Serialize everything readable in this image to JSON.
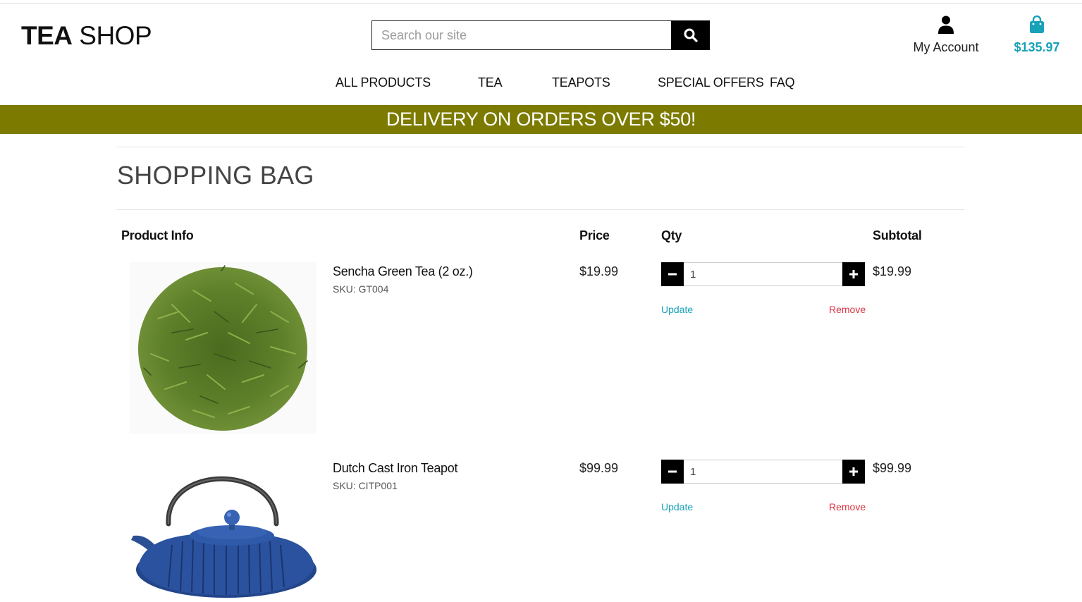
{
  "header": {
    "logo_bold": "TEA",
    "logo_light": "SHOP",
    "search_placeholder": "Search our site",
    "account_label": "My Account",
    "bag_total": "$135.97"
  },
  "nav": {
    "items": [
      "ALL PRODUCTS",
      "TEA",
      "TEAPOTS",
      "SPECIAL OFFERS",
      "FAQ"
    ]
  },
  "banner": {
    "text": "DELIVERY ON ORDERS OVER $50!"
  },
  "bag": {
    "title": "SHOPPING BAG",
    "columns": {
      "product": "Product Info",
      "price": "Price",
      "qty": "Qty",
      "subtotal": "Subtotal"
    },
    "items": [
      {
        "name": "Sencha Green Tea (2 oz.)",
        "sku": "SKU: GT004",
        "price": "$19.99",
        "qty": "1",
        "subtotal": "$19.99",
        "update": "Update",
        "remove": "Remove"
      },
      {
        "name": "Dutch Cast Iron Teapot",
        "sku": "SKU: CITP001",
        "price": "$99.99",
        "qty": "1",
        "subtotal": "$99.99",
        "update": "Update",
        "remove": "Remove"
      }
    ]
  },
  "colors": {
    "banner": "#7c7b00",
    "accent": "#17a2b8",
    "remove": "#dc3545"
  }
}
